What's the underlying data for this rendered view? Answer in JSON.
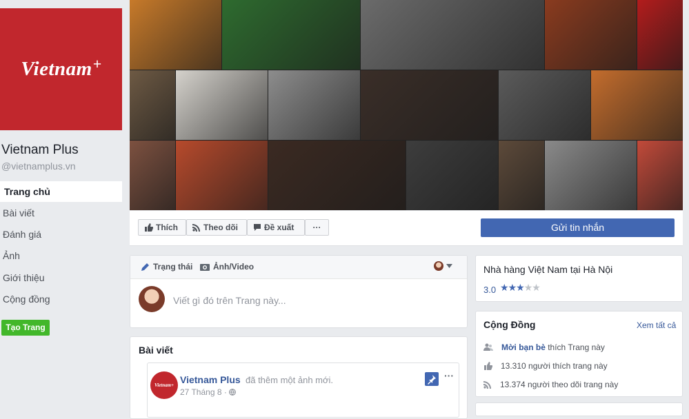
{
  "page": {
    "logo_text": "Vietnam",
    "logo_plus": "+",
    "name": "Vietnam Plus",
    "handle": "@vietnamplus.vn"
  },
  "nav": {
    "items": [
      {
        "label": "Trang chủ"
      },
      {
        "label": "Bài viết"
      },
      {
        "label": "Đánh giá"
      },
      {
        "label": "Ảnh"
      },
      {
        "label": "Giới thiệu"
      },
      {
        "label": "Cộng đồng"
      }
    ],
    "create_page": "Tạo Trang"
  },
  "actions": {
    "like": "Thích",
    "follow": "Theo dõi",
    "suggest": "Đề xuất",
    "more": "···",
    "send_message": "Gửi tin nhắn"
  },
  "composer": {
    "status": "Trạng thái",
    "photo_video": "Ảnh/Video",
    "placeholder": "Viết gì đó trên Trang này..."
  },
  "posts": {
    "title": "Bài viết",
    "post": {
      "avatar_text": "Vietnam+",
      "author": "Vietnam Plus",
      "action": "đã thêm một ảnh mới.",
      "date": "27 Tháng 8",
      "menu": "···"
    }
  },
  "rating": {
    "category": "Nhà hàng Việt Nam tại Hà Nội",
    "value": "3.0",
    "stars_filled": 3,
    "stars_total": 5
  },
  "community": {
    "title": "Cộng Đồng",
    "see_all": "Xem tất cả",
    "invite_link": "Mời bạn bè",
    "invite_rest": " thích Trang này",
    "likes": "13.310 người thích trang này",
    "follows": "13.374 người theo dõi trang này"
  },
  "colors": {
    "brand_red": "#c1272d",
    "fb_blue": "#4267b2",
    "link_blue": "#365899",
    "green": "#42b72a",
    "star_blue": "#4267b2",
    "star_grey": "#bec3c9"
  },
  "cover_tiles": [
    "#c77a2a",
    "#2e6b2f",
    "#6b6b6b",
    "#8a3b1f",
    "#b31c1c",
    "#6e5a44",
    "#d5d2cc",
    "#8d8d8d",
    "#3a2e28",
    "#5b5b5b",
    "#c46d2d",
    "#7d5140",
    "#b74a2c",
    "#3b2a22",
    "#3d3d3d",
    "#5d4a3a",
    "#8a8a8a",
    "#c24a3a"
  ]
}
